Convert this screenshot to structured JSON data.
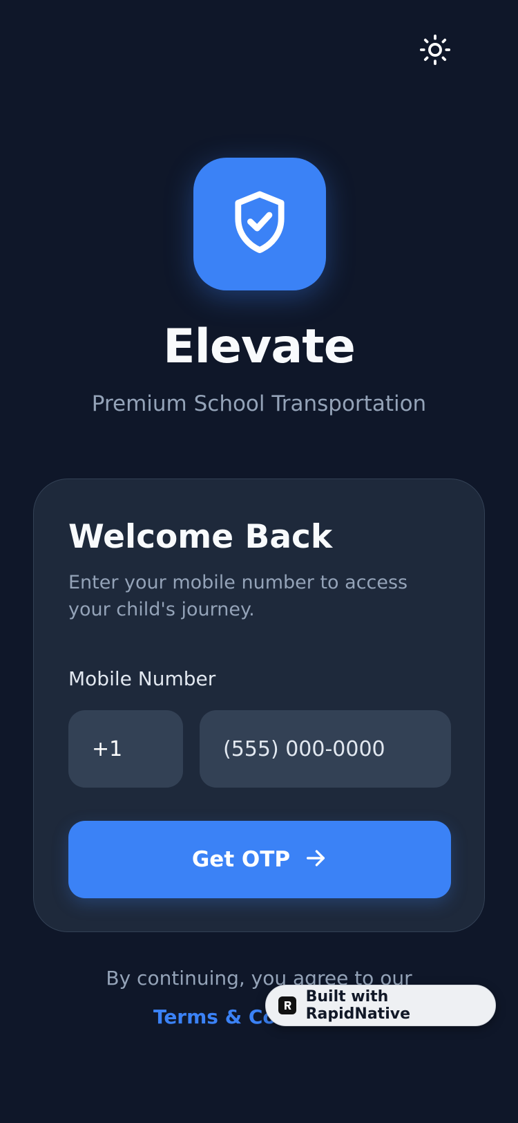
{
  "theme_toggle": {
    "icon": "sun-icon"
  },
  "brand": {
    "logo_icon": "shield-check-icon",
    "title": "Elevate",
    "subtitle": "Premium School Transportation",
    "accent_color": "#3b82f6"
  },
  "login_card": {
    "title": "Welcome Back",
    "description": "Enter your mobile number to access your child's journey.",
    "mobile_label": "Mobile Number",
    "country_code": "+1",
    "phone_placeholder": "(555) 000-0000",
    "phone_value": "",
    "submit_label": "Get OTP",
    "submit_icon": "arrow-right-icon"
  },
  "footer": {
    "agree_text": "By continuing, you agree to our",
    "terms_link": "Terms & Conditions"
  },
  "badge": {
    "label": "Built with RapidNative",
    "icon": "rapidnative-logo-icon"
  }
}
